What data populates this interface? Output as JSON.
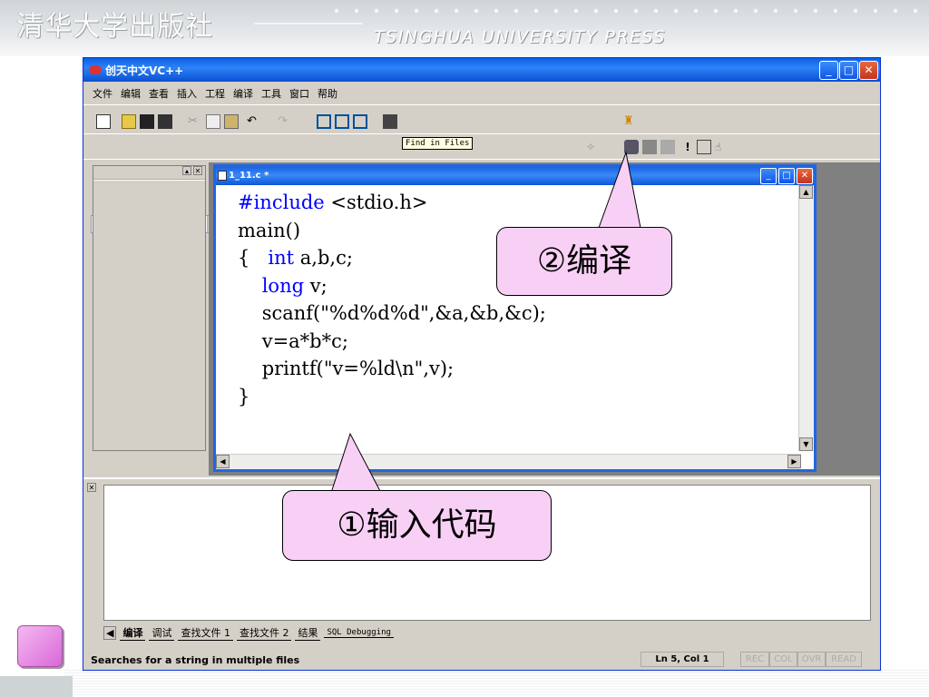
{
  "slide": {
    "publisher": "清华大学出版社",
    "publisher_en": "TSINGHUA UNIVERSITY PRESS"
  },
  "window": {
    "title": "创天中文VC++"
  },
  "menu": [
    "文件",
    "编辑",
    "查看",
    "插入",
    "工程",
    "编译",
    "工具",
    "窗口",
    "帮助"
  ],
  "tooltip": "Find in Files",
  "editor": {
    "title": "1_11.c *",
    "lines": [
      "#include <stdio.h>",
      "main()",
      "{   int a,b,c;",
      "    long v;",
      "",
      "    scanf(\"%d%d%d\",&a,&b,&c);",
      "    v=a*b*c;",
      "    printf(\"v=%ld\\n\",v);",
      "}"
    ]
  },
  "output_tabs": [
    "编译",
    "调试",
    "查找文件 1",
    "查找文件 2",
    "结果",
    "SQL Debugging"
  ],
  "status": {
    "message": "Searches for a string in multiple files",
    "position": "Ln 5, Col 1",
    "indicators": [
      "REC",
      "COL",
      "OVR",
      "READ"
    ]
  },
  "callouts": {
    "compile": "②编译",
    "input_code": "①输入代码"
  },
  "colors": {
    "titlebar": "#0a5fe6",
    "callout": "#f9d0f5",
    "keyword": "#0000ff"
  }
}
